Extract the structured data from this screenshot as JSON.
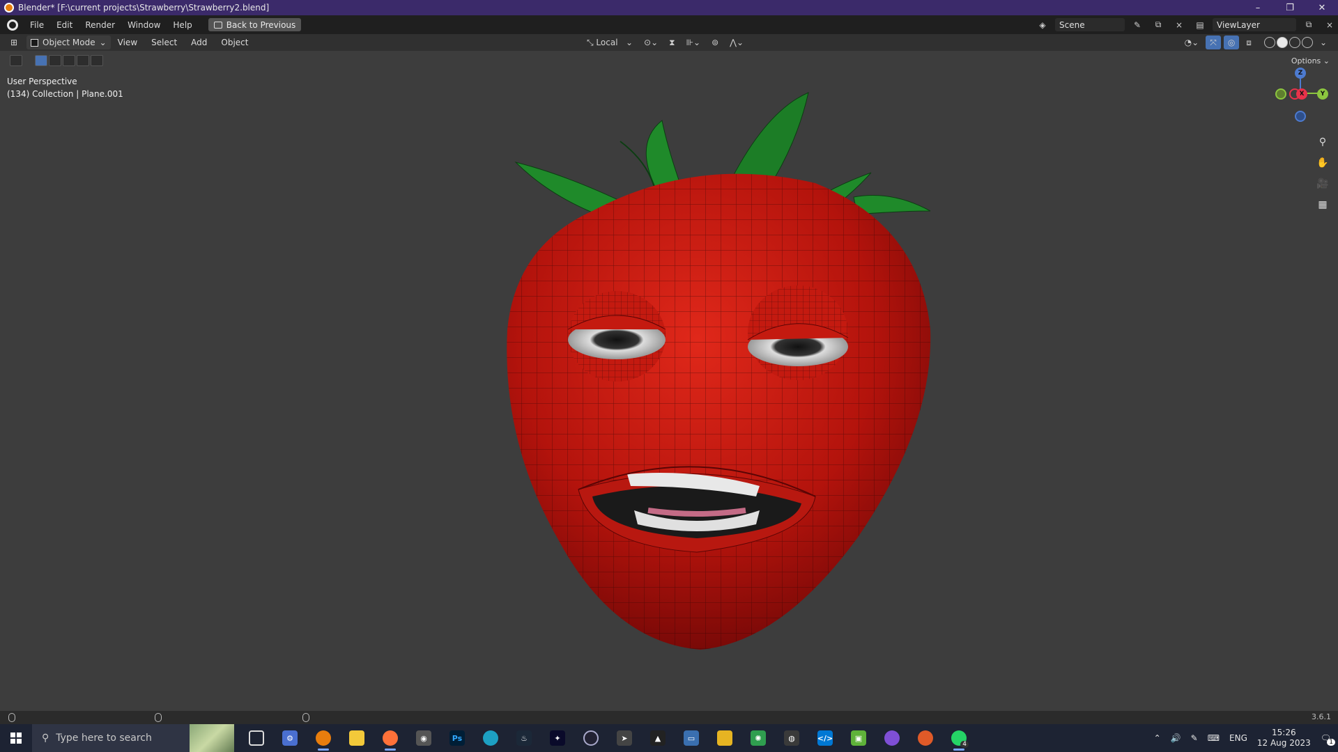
{
  "titlebar": {
    "title": "Blender* [F:\\current projects\\Strawberry\\Strawberry2.blend]",
    "minimize": "–",
    "restore": "❐",
    "close": "✕"
  },
  "menubar": {
    "items": [
      "File",
      "Edit",
      "Render",
      "Window",
      "Help"
    ],
    "back_button": "Back to Previous",
    "scene": "Scene",
    "view_layer": "ViewLayer"
  },
  "header": {
    "mode": "Object Mode",
    "menus": [
      "View",
      "Select",
      "Add",
      "Object"
    ],
    "orientation": "Local",
    "options": "Options"
  },
  "viewport": {
    "perspective": "User Perspective",
    "collection": "(134) Collection | Plane.001",
    "gizmo": {
      "x": "X",
      "y": "Y",
      "z": "Z"
    },
    "model": {
      "body_color": "#c0170f",
      "leaf_color": "#1f8a2a",
      "wire_color": "#2a0505"
    }
  },
  "statusbar": {
    "version": "3.6.1"
  },
  "taskbar": {
    "search_placeholder": "Type here to search",
    "apps": [
      "task-view",
      "app-gear",
      "blender",
      "file-explorer",
      "firefox",
      "camera",
      "photoshop",
      "edge",
      "steam",
      "app-dark",
      "app-circle",
      "app-wing",
      "app-inkscape",
      "app-monitor",
      "app-leaf",
      "app-sparkle",
      "app-gamepad",
      "vscode",
      "minecraft",
      "github",
      "app-sphere",
      "whatsapp"
    ],
    "whatsapp_badge": "4",
    "language": "ENG",
    "time": "15:26",
    "date": "12 Aug 2023",
    "notif_badge": "1"
  }
}
